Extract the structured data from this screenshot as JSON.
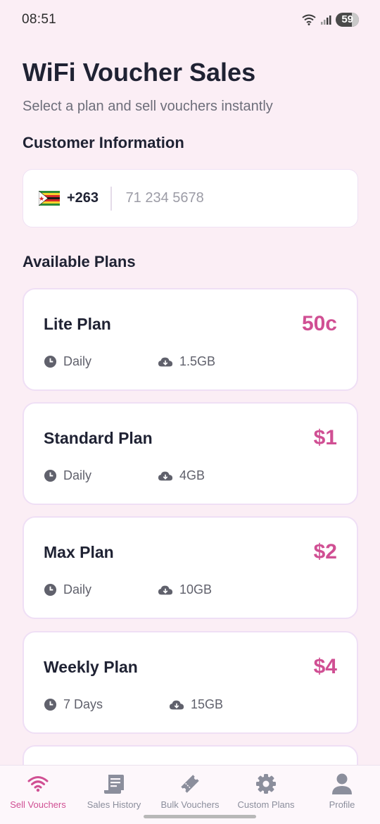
{
  "status_bar": {
    "time": "08:51",
    "battery": "59"
  },
  "header": {
    "title": "WiFi Voucher Sales",
    "subtitle": "Select a plan and sell vouchers instantly"
  },
  "customer": {
    "section_title": "Customer Information",
    "country_code": "+263",
    "flag_icon": "zimbabwe-flag-icon",
    "phone_placeholder": "71 234 5678"
  },
  "plans": {
    "section_title": "Available Plans",
    "items": [
      {
        "name": "Lite Plan",
        "price": "50c",
        "period": "Daily",
        "data": "1.5GB"
      },
      {
        "name": "Standard Plan",
        "price": "$1",
        "period": "Daily",
        "data": "4GB"
      },
      {
        "name": "Max Plan",
        "price": "$2",
        "period": "Daily",
        "data": "10GB"
      },
      {
        "name": "Weekly Plan",
        "price": "$4",
        "period": "7 Days",
        "data": "15GB"
      }
    ]
  },
  "bottom_nav": {
    "items": [
      {
        "label": "Sell Vouchers",
        "icon": "wifi-icon",
        "active": true
      },
      {
        "label": "Sales History",
        "icon": "receipt-icon",
        "active": false
      },
      {
        "label": "Bulk Vouchers",
        "icon": "ticket-icon",
        "active": false
      },
      {
        "label": "Custom Plans",
        "icon": "gear-icon",
        "active": false
      },
      {
        "label": "Profile",
        "icon": "person-icon",
        "active": false
      }
    ]
  },
  "colors": {
    "background": "#fbeef5",
    "accent": "#d04f93",
    "text": "#1f2233",
    "muted": "#6d6e7a"
  }
}
